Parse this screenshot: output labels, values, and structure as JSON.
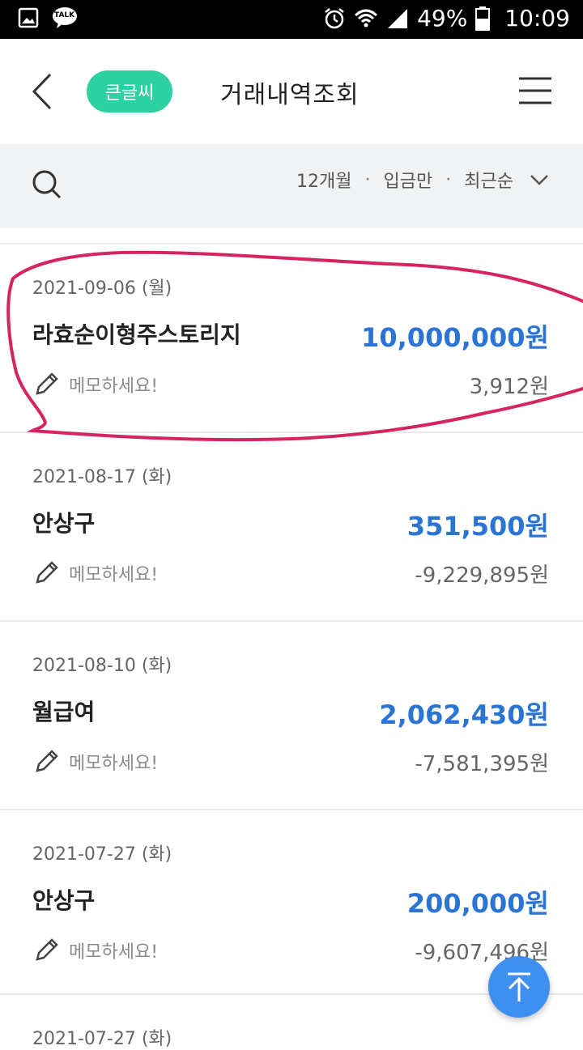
{
  "statusbar": {
    "battery": "49%",
    "time": "10:09",
    "icons": [
      "gallery-icon",
      "kakaotalk-icon",
      "alarm-icon",
      "wifi-icon",
      "signal-icon",
      "battery-icon"
    ],
    "talk_label": "TALK"
  },
  "header": {
    "back_icon": "chevron-left-icon",
    "badge": "큰글씨",
    "title": "거래내역조회",
    "menu_icon": "hamburger-icon"
  },
  "filters": {
    "period": "12개월",
    "type": "입금만",
    "sort": "최근순",
    "separator": "·"
  },
  "transactions": [
    {
      "date": "2021-09-06 (월)",
      "name": "라효순이형주스토리지",
      "amount": "10,000,000원",
      "memo": "메모하세요!",
      "balance": "3,912원"
    },
    {
      "date": "2021-08-17 (화)",
      "name": "안상구",
      "amount": "351,500원",
      "memo": "메모하세요!",
      "balance": "-9,229,895원"
    },
    {
      "date": "2021-08-10 (화)",
      "name": "월급여",
      "amount": "2,062,430원",
      "memo": "메모하세요!",
      "balance": "-7,581,395원"
    },
    {
      "date": "2021-07-27 (화)",
      "name": "안상구",
      "amount": "200,000원",
      "memo": "메모하세요!",
      "balance": "-9,607,496원"
    },
    {
      "date": "2021-07-27 (화)"
    }
  ],
  "colors": {
    "accent_green": "#2ed1a2",
    "amount_blue": "#2a74d4",
    "fab_blue": "#3d8ff0",
    "highlight_pink": "#d6245f"
  }
}
